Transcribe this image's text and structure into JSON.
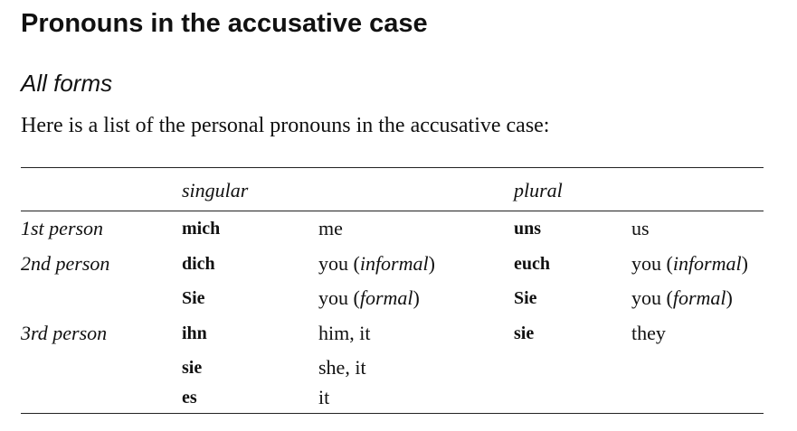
{
  "heading": "Pronouns in the accusative case",
  "subheading": "All forms",
  "intro": "Here is a list of the personal pronouns in the accusative case:",
  "table": {
    "headers": {
      "singular": "singular",
      "plural": "plural"
    },
    "rows": [
      {
        "person": "1st person",
        "sing_de": "mich",
        "sing_en": "me",
        "plur_de": "uns",
        "plur_en": "us"
      },
      {
        "person": "2nd person",
        "sing_de": "dich",
        "sing_en": {
          "pre": "you (",
          "it": "informal",
          "post": ")"
        },
        "plur_de": "euch",
        "plur_en": {
          "pre": "you (",
          "it": "informal",
          "post": ")"
        }
      },
      {
        "person": "",
        "sing_de": "Sie",
        "sing_en": {
          "pre": "you (",
          "it": "formal",
          "post": ")"
        },
        "plur_de": "Sie",
        "plur_en": {
          "pre": "you (",
          "it": "formal",
          "post": ")"
        }
      },
      {
        "person": "3rd person",
        "sing_de": "ihn",
        "sing_en": "him, it",
        "plur_de": "sie",
        "plur_en": "they"
      },
      {
        "person": "",
        "sing_de": "sie",
        "sing_en": "she, it",
        "plur_de": "",
        "plur_en": ""
      },
      {
        "person": "",
        "sing_de": "es",
        "sing_en": "it",
        "plur_de": "",
        "plur_en": ""
      }
    ]
  }
}
